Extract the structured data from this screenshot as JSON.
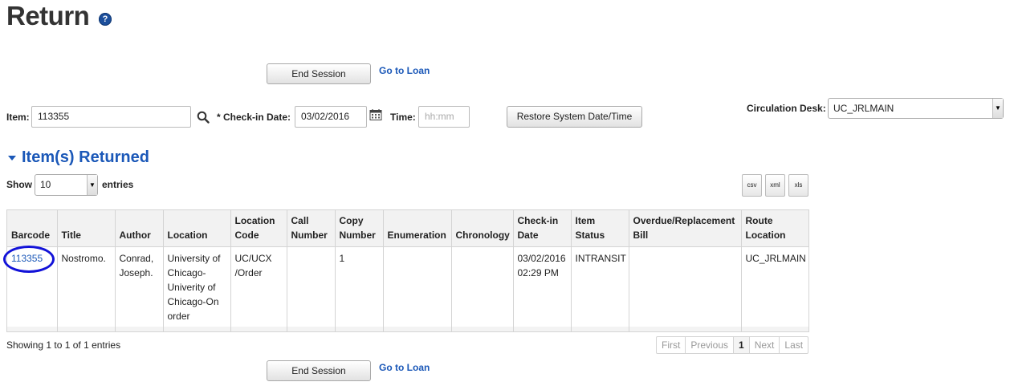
{
  "page": {
    "title": "Return",
    "help_icon": "question-mark-icon"
  },
  "top_actions": {
    "end_session": "End Session",
    "go_to_loan": "Go to Loan"
  },
  "form": {
    "item_label": "Item:",
    "item_value": "113355",
    "search_icon": "magnifier-icon",
    "checkin_date_label": "* Check-in Date:",
    "checkin_date_value": "03/02/2016",
    "calendar_icon": "calendar-icon",
    "time_label": "Time:",
    "time_placeholder": "hh:mm",
    "restore_button": "Restore System Date/Time",
    "circ_desk_label": "Circulation Desk:",
    "circ_desk_value": "UC_JRLMAIN"
  },
  "section": {
    "title": "Item(s) Returned"
  },
  "table_controls": {
    "show_label": "Show",
    "entries_value": "10",
    "entries_label": "entries",
    "export_buttons": [
      "csv",
      "xml",
      "xls"
    ]
  },
  "table": {
    "headers": [
      [
        "Barcode"
      ],
      [
        "Title"
      ],
      [
        "Author"
      ],
      [
        "Location"
      ],
      [
        "Location",
        "Code"
      ],
      [
        "Call",
        "Number"
      ],
      [
        "Copy",
        "Number"
      ],
      [
        "Enumeration"
      ],
      [
        "Chronology"
      ],
      [
        "Check-in",
        "Date"
      ],
      [
        "Item",
        "Status"
      ],
      [
        "Overdue/Replacement",
        "Bill"
      ],
      [
        "Route",
        "Location"
      ]
    ],
    "rows": [
      {
        "barcode": "113355",
        "title": "Nostromo.",
        "author": [
          "Conrad,",
          "Joseph."
        ],
        "location": [
          "University of",
          "Chicago-",
          "Univerity of",
          "Chicago-On",
          "order"
        ],
        "location_code": [
          "UC/UCX",
          "/Order"
        ],
        "call_number": "",
        "copy_number": "1",
        "enumeration": "",
        "chronology": "",
        "checkin_date": [
          "03/02/2016",
          "02:29 PM"
        ],
        "item_status": "INTRANSIT",
        "overdue_bill": "",
        "route_location": "UC_JRLMAIN"
      }
    ]
  },
  "table_footer": {
    "info": "Showing 1 to 1 of 1 entries",
    "pager": [
      "First",
      "Previous",
      "1",
      "Next",
      "Last"
    ]
  },
  "bottom_actions": {
    "end_session": "End Session",
    "go_to_loan": "Go to Loan"
  }
}
